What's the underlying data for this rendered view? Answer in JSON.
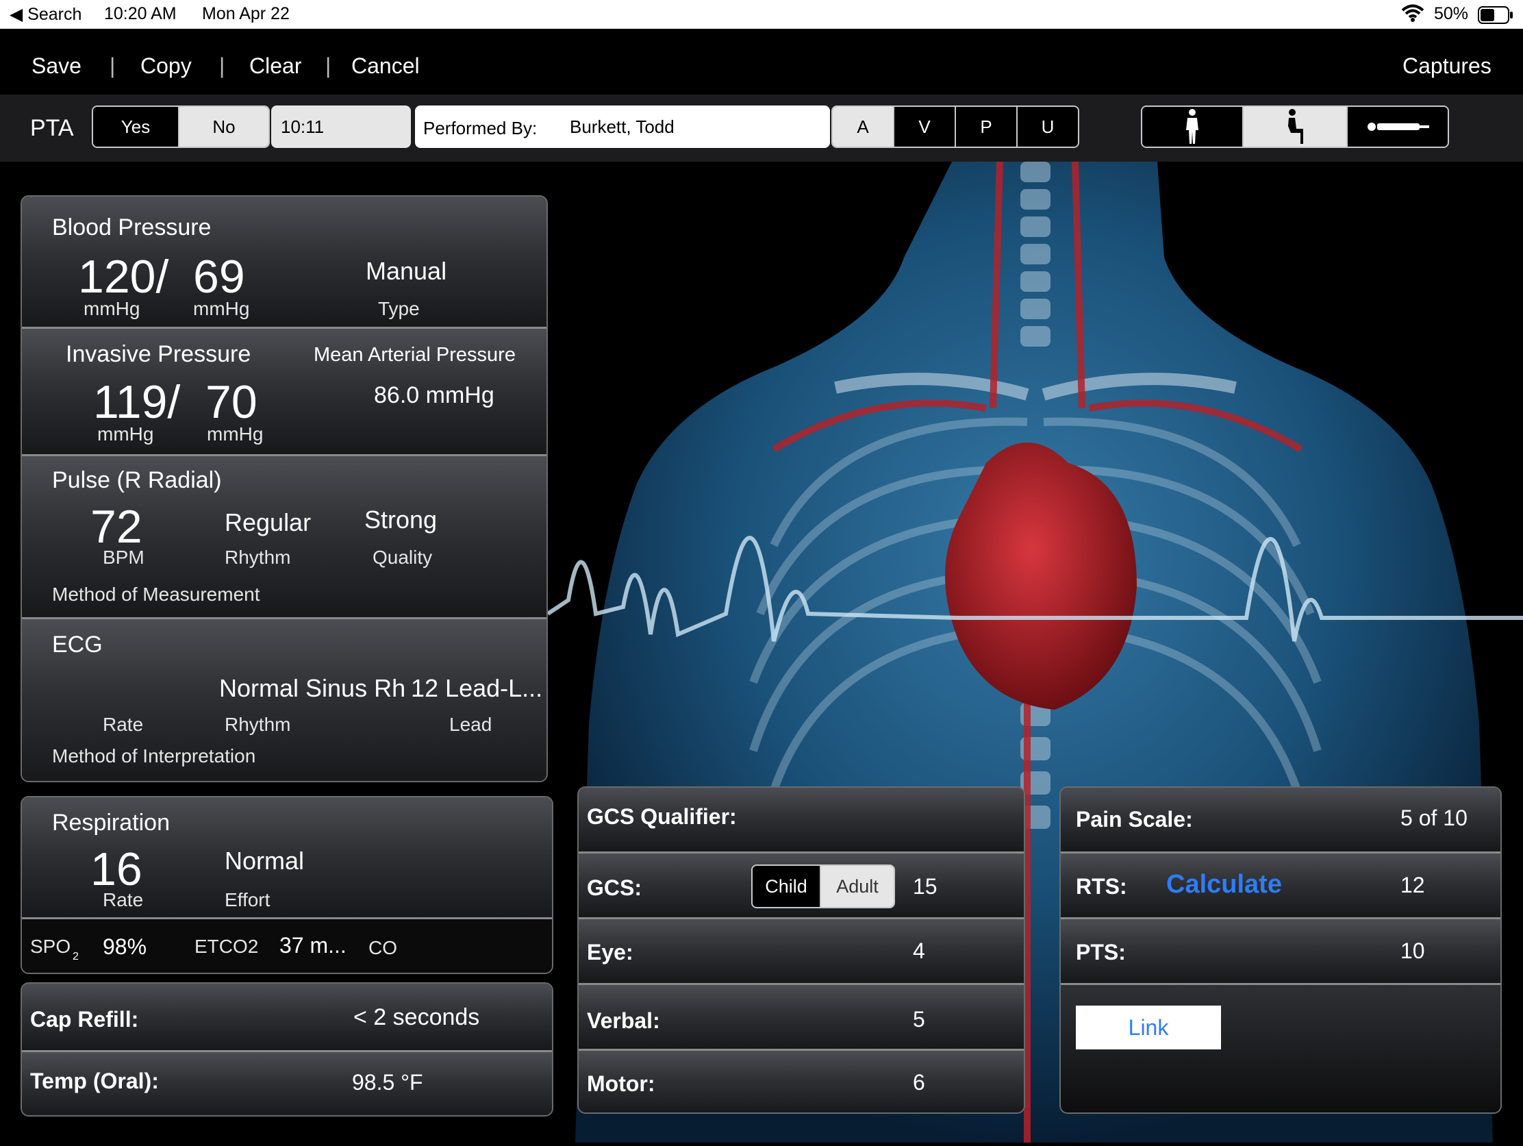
{
  "status_bar": {
    "back": "◀ Search",
    "time": "10:20 AM",
    "date": "Mon Apr 22",
    "battery": "50%"
  },
  "nav": {
    "save": "Save",
    "copy": "Copy",
    "clear": "Clear",
    "cancel": "Cancel",
    "captures": "Captures",
    "separator": "|"
  },
  "toolbar": {
    "pta_label": "PTA",
    "yes": "Yes",
    "no": "No",
    "time": "10:11",
    "performed_by_label": "Performed By:",
    "performed_by": "Burkett, Todd",
    "avpu": [
      "A",
      "V",
      "P",
      "U"
    ],
    "positions": [
      "standing-person-icon",
      "sitting-person-icon",
      "lying-person-icon"
    ]
  },
  "blood_pressure": {
    "title": "Blood Pressure",
    "systolic": "120/",
    "diastolic": "69",
    "unit": "mmHg",
    "type_value": "Manual",
    "type_label": "Type"
  },
  "invasive_pressure": {
    "title": "Invasive Pressure",
    "systolic": "119/",
    "diastolic": "70",
    "unit": "mmHg",
    "map_label": "Mean Arterial Pressure",
    "map_value": "86.0 mmHg"
  },
  "pulse": {
    "title": "Pulse (R Radial)",
    "rate": "72",
    "rate_unit": "BPM",
    "rhythm": "Regular",
    "rhythm_label": "Rhythm",
    "quality": "Strong",
    "quality_label": "Quality",
    "method_label": "Method of Measurement"
  },
  "ecg": {
    "title": "ECG",
    "rhythm_value": "Normal Sinus Rh",
    "lead_value": "12 Lead-L...",
    "rate_label": "Rate",
    "rhythm_label": "Rhythm",
    "lead_label": "Lead",
    "method_label": "Method of Interpretation"
  },
  "respiration": {
    "title": "Respiration",
    "rate": "16",
    "rate_label": "Rate",
    "effort": "Normal",
    "effort_label": "Effort",
    "spo2_label": "SPO",
    "spo2_sub": "2",
    "spo2": "98%",
    "etco2_label": "ETCO2",
    "etco2": "37 m...",
    "co_label": "CO"
  },
  "cap_refill": {
    "label": "Cap Refill:",
    "value": "< 2 seconds"
  },
  "temp": {
    "label": "Temp (Oral):",
    "value": "98.5 °F"
  },
  "gcs": {
    "qualifier_label": "GCS Qualifier:",
    "gcs_label": "GCS:",
    "child": "Child",
    "adult": "Adult",
    "total": "15",
    "eye_label": "Eye:",
    "eye": "4",
    "verbal_label": "Verbal:",
    "verbal": "5",
    "motor_label": "Motor:",
    "motor": "6"
  },
  "scores": {
    "pain_label": "Pain Scale:",
    "pain": "5 of 10",
    "rts_label": "RTS:",
    "calculate": "Calculate",
    "rts": "12",
    "pts_label": "PTS:",
    "pts": "10",
    "link": "Link"
  },
  "colors": {
    "accent": "#2f7cf6",
    "artery": "#b3222a",
    "body": "#2a6d9c"
  }
}
